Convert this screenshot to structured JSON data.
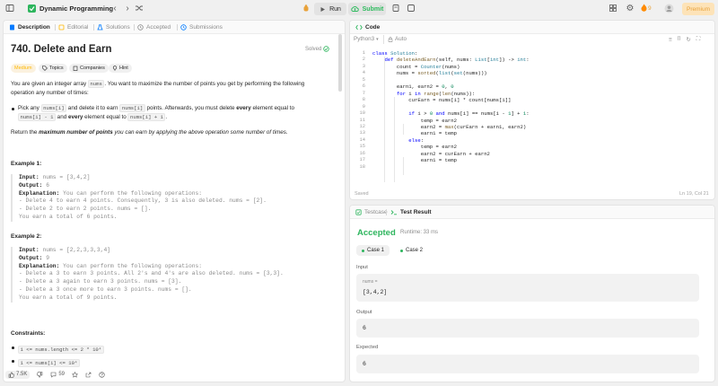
{
  "topbar": {
    "title": "Dynamic Programming",
    "run_label": "Run",
    "submit_label": "Submit",
    "streak_count": "9",
    "premium_label": "Premium"
  },
  "left_tabs": [
    {
      "label": "Description"
    },
    {
      "label": "Editorial"
    },
    {
      "label": "Solutions"
    },
    {
      "label": "Accepted"
    },
    {
      "label": "Submissions"
    }
  ],
  "problem": {
    "title": "740. Delete and Earn",
    "status": "Solved",
    "tags": [
      "Medium",
      "Topics",
      "Companies",
      "Hint"
    ],
    "intro_a": "You are given an integer array ",
    "intro_code": "nums",
    "intro_b": ". You want to maximize the number of points you get by performing the following",
    "intro_c": "operation any number of times:",
    "bullet_a": "Pick any ",
    "bullet_code1": "nums[i]",
    "bullet_b": " and delete it to earn ",
    "bullet_code2": "nums[i]",
    "bullet_c": " points. Afterwards, you must delete ",
    "bullet_every": "every",
    "bullet_d": " element equal to",
    "bullet_code3": "nums[i] - 1",
    "bullet_e": " and ",
    "bullet_every2": "every",
    "bullet_f": " element equal to ",
    "bullet_code4": "nums[i] + 1",
    "bullet_g": ".",
    "return_a": "Return the ",
    "return_b": "maximum number of points",
    "return_c": " you can earn by applying the above operation some number of times."
  },
  "examples": [
    {
      "heading": "Example 1:",
      "input": "nums = [3,4,2]",
      "output": "6",
      "explanation": "You can perform the following operations:",
      "lines": [
        "- Delete 4 to earn 4 points. Consequently, 3 is also deleted. nums = [2].",
        "- Delete 2 to earn 2 points. nums = [].",
        "You earn a total of 6 points."
      ]
    },
    {
      "heading": "Example 2:",
      "input": "nums = [2,2,3,3,3,4]",
      "output": "9",
      "explanation": "You can perform the following operations:",
      "lines": [
        "- Delete a 3 to earn 3 points. All 2's and 4's are also deleted. nums = [3,3].",
        "- Delete a 3 again to earn 3 points. nums = [3].",
        "- Delete a 3 once more to earn 3 points. nums = [].",
        "You earn a total of 9 points."
      ]
    }
  ],
  "labels": {
    "input": "Input:",
    "output": "Output:",
    "explanation": "Explanation:"
  },
  "constraints": {
    "heading": "Constraints:",
    "items": [
      "1 <= nums.length <= 2 * 10⁴",
      "1 <= nums[i] <= 10⁴"
    ]
  },
  "footer": {
    "likes": "7.5K",
    "comments": "59"
  },
  "editor": {
    "tab_label": "Code",
    "language": "Python3",
    "autosave": "Auto",
    "saved_text": "Saved",
    "cursor_pos": "Ln 19, Col 21",
    "line_numbers": [
      "1",
      "2",
      "3",
      "4",
      "5",
      "6",
      "7",
      "8",
      "9",
      "10",
      "11",
      "12",
      "13",
      "14",
      "15",
      "16",
      "17",
      "18"
    ]
  },
  "result": {
    "tab_testcase": "Testcase",
    "tab_result": "Test Result",
    "status": "Accepted",
    "runtime": "Runtime: 33 ms",
    "cases": [
      "Case 1",
      "Case 2"
    ],
    "input_label": "Input",
    "input_var": "nums =",
    "input_value": "[3,4,2]",
    "output_label": "Output",
    "output_value": "6",
    "expected_label": "Expected",
    "expected_value": "6"
  },
  "colors": {
    "accepted": "#2db55d",
    "medium": "#ffb800",
    "premium": "#e8a23a"
  }
}
